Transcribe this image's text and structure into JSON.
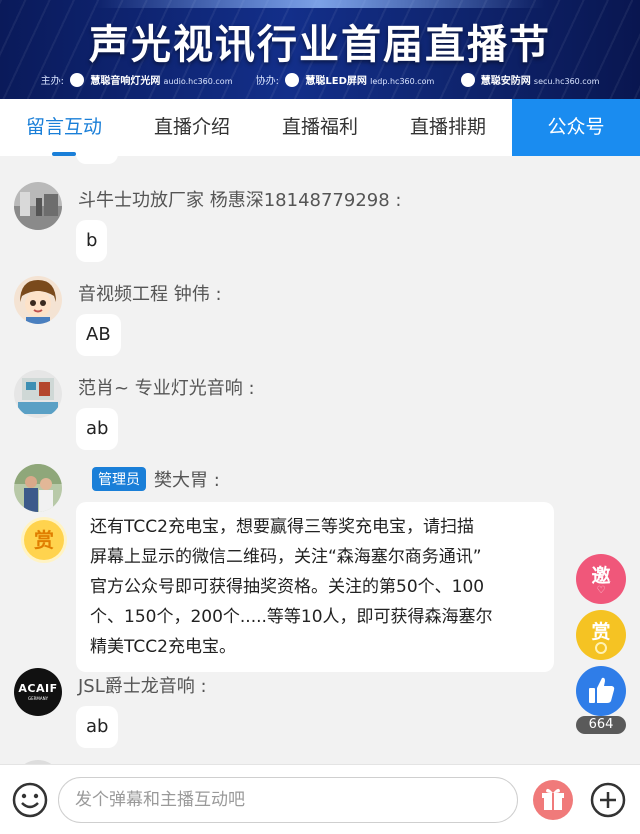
{
  "banner": {
    "title": "声光视讯行业首届直播节",
    "organizer_label": "主办:",
    "organizer_name": "慧聪音响灯光网",
    "organizer_url": "audio.hc360.com",
    "co_label": "协办:",
    "co1_name": "慧聪LED屏网",
    "co1_url": "ledp.hc360.com",
    "co2_name": "慧聪安防网",
    "co2_url": "secu.hc360.com"
  },
  "tabs": [
    {
      "label": "留言互动"
    },
    {
      "label": "直播介绍"
    },
    {
      "label": "直播福利"
    },
    {
      "label": "直播排期"
    },
    {
      "label": "公众号"
    }
  ],
  "messages": [
    {
      "user": "斗牛士功放厂家 杨惠深18148779298 :",
      "text": "b"
    },
    {
      "user": "音视频工程 钟伟 :",
      "text": "AB"
    },
    {
      "user": "范肖~ 专业灯光音响 :",
      "text": "ab"
    },
    {
      "badge": "管理员",
      "user": "樊大胃 :",
      "reward": "赏",
      "text_lines": [
        "还有TCC2充电宝，想要赢得三等奖充电宝，请扫描",
        "屏幕上显示的微信二维码，关注“森海塞尔商务通讯”",
        "官方公众号即可获得抽奖资格。关注的第50个、100",
        "个、150个，200个.....等等10人，即可获得森海塞尔",
        "精美TCC2充电宝。"
      ]
    },
    {
      "user": "JSL爵士龙音响 :",
      "text": "ab",
      "avatar_text": "ACAIF",
      "avatar_sub": "GERMANY"
    }
  ],
  "floating": {
    "invite_label": "邀",
    "reward_label": "赏",
    "like_count": "664"
  },
  "input": {
    "placeholder": "发个弹幕和主播互动吧"
  },
  "colors": {
    "accent": "#1a7fd8",
    "tab_blue": "#1a8cf0",
    "invite": "#f0577a",
    "reward": "#f5c323",
    "like": "#2f7de8"
  }
}
